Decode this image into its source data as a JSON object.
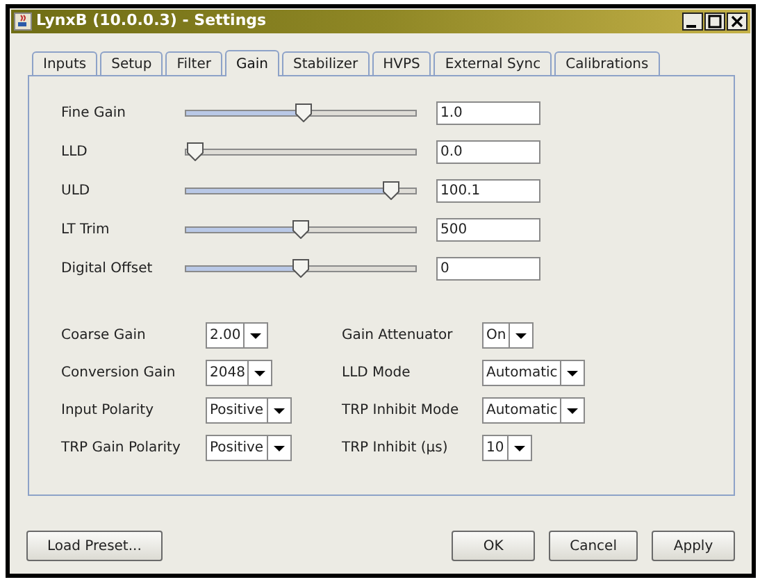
{
  "window": {
    "title": "LynxB (10.0.0.3) - Settings"
  },
  "tabs": [
    {
      "label": "Inputs",
      "selected": false
    },
    {
      "label": "Setup",
      "selected": false
    },
    {
      "label": "Filter",
      "selected": false
    },
    {
      "label": "Gain",
      "selected": true
    },
    {
      "label": "Stabilizer",
      "selected": false
    },
    {
      "label": "HVPS",
      "selected": false
    },
    {
      "label": "External Sync",
      "selected": false
    },
    {
      "label": "Calibrations",
      "selected": false
    }
  ],
  "sliders": [
    {
      "label": "Fine Gain",
      "level": 0.51,
      "value": "1.0"
    },
    {
      "label": "LLD",
      "level": 0.0,
      "value": "0.0"
    },
    {
      "label": "ULD",
      "level": 0.93,
      "value": "100.1"
    },
    {
      "label": "LT Trim",
      "level": 0.5,
      "value": "500"
    },
    {
      "label": "Digital Offset",
      "level": 0.5,
      "value": "0"
    }
  ],
  "combos_left": [
    {
      "label": "Coarse Gain",
      "value": "2.00"
    },
    {
      "label": "Conversion Gain",
      "value": "2048"
    },
    {
      "label": "Input Polarity",
      "value": "Positive"
    },
    {
      "label": "TRP Gain Polarity",
      "value": "Positive"
    }
  ],
  "combos_right": [
    {
      "label": "Gain Attenuator",
      "value": "On"
    },
    {
      "label": "LLD Mode",
      "value": "Automatic"
    },
    {
      "label": "TRP Inhibit Mode",
      "value": "Automatic"
    },
    {
      "label": "TRP Inhibit (µs)",
      "value": "10"
    }
  ],
  "buttons_left": [
    "Load Preset..."
  ],
  "buttons_right": [
    "OK",
    "Cancel",
    "Apply"
  ]
}
